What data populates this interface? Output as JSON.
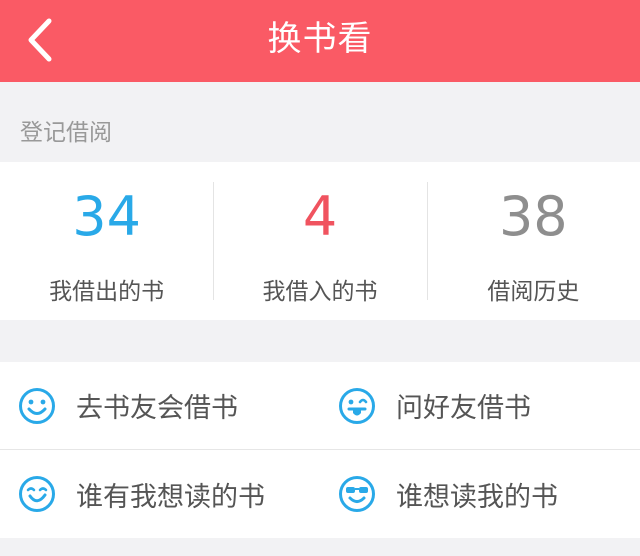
{
  "header": {
    "title": "换书看"
  },
  "register": {
    "section_label": "登记借阅",
    "stats": [
      {
        "value": "34",
        "label": "我借出的书",
        "color": "#29a9e8"
      },
      {
        "value": "4",
        "label": "我借入的书",
        "color": "#f0535f"
      },
      {
        "value": "38",
        "label": "借阅历史",
        "color": "#8e8e8e"
      }
    ]
  },
  "actions": [
    {
      "label": "去书友会借书",
      "icon": "smile-face-icon"
    },
    {
      "label": "问好友借书",
      "icon": "tongue-face-icon"
    },
    {
      "label": "谁有我想读的书",
      "icon": "grin-face-icon"
    },
    {
      "label": "谁想读我的书",
      "icon": "sunglasses-face-icon"
    }
  ],
  "colors": {
    "header_bg": "#fa5a65",
    "icon": "#29a9e8"
  }
}
